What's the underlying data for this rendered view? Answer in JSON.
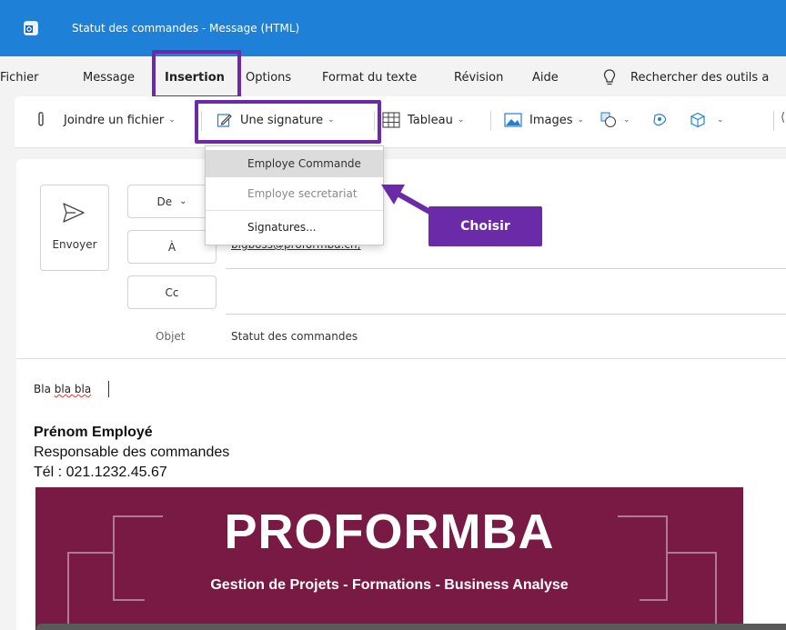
{
  "window": {
    "title": "Statut des commandes  -  Message (HTML)",
    "app_icon": "outlook-icon",
    "accent": "#1f80d7"
  },
  "menu": {
    "items": [
      "Fichier",
      "Message",
      "Insertion",
      "Options",
      "Format du texte",
      "Révision",
      "Aide"
    ],
    "search_icon": "lightbulb-icon",
    "search_text": "Rechercher des outils a"
  },
  "ribbon": {
    "attach": "Joindre un fichier",
    "signature": "Une signature",
    "table": "Tableau",
    "images": "Images"
  },
  "signature_menu": {
    "items": [
      "Employe Commande",
      "Employe secretariat",
      "Signatures..."
    ],
    "selected": "Employe Commande"
  },
  "callout": {
    "text": "Choisir",
    "color": "#6b2aa8"
  },
  "compose": {
    "send_label": "Envoyer",
    "from_label": "De",
    "to_label": "À",
    "cc_label": "Cc",
    "to_value": "bigboss@proformba.ch;",
    "subject_label": "Objet",
    "subject_value": "Statut des commandes"
  },
  "body": {
    "text_1": "Bla",
    "text_2": "bla bla",
    "sig_name": "Prénom Employé",
    "sig_role": "Responsable des commandes",
    "sig_phone": "Tél : 021.1232.45.67",
    "banner_title": "PROFORMBA",
    "banner_subtitle": "Gestion de Projets - Formations -  Business Analyse",
    "banner_color": "#791a44"
  }
}
